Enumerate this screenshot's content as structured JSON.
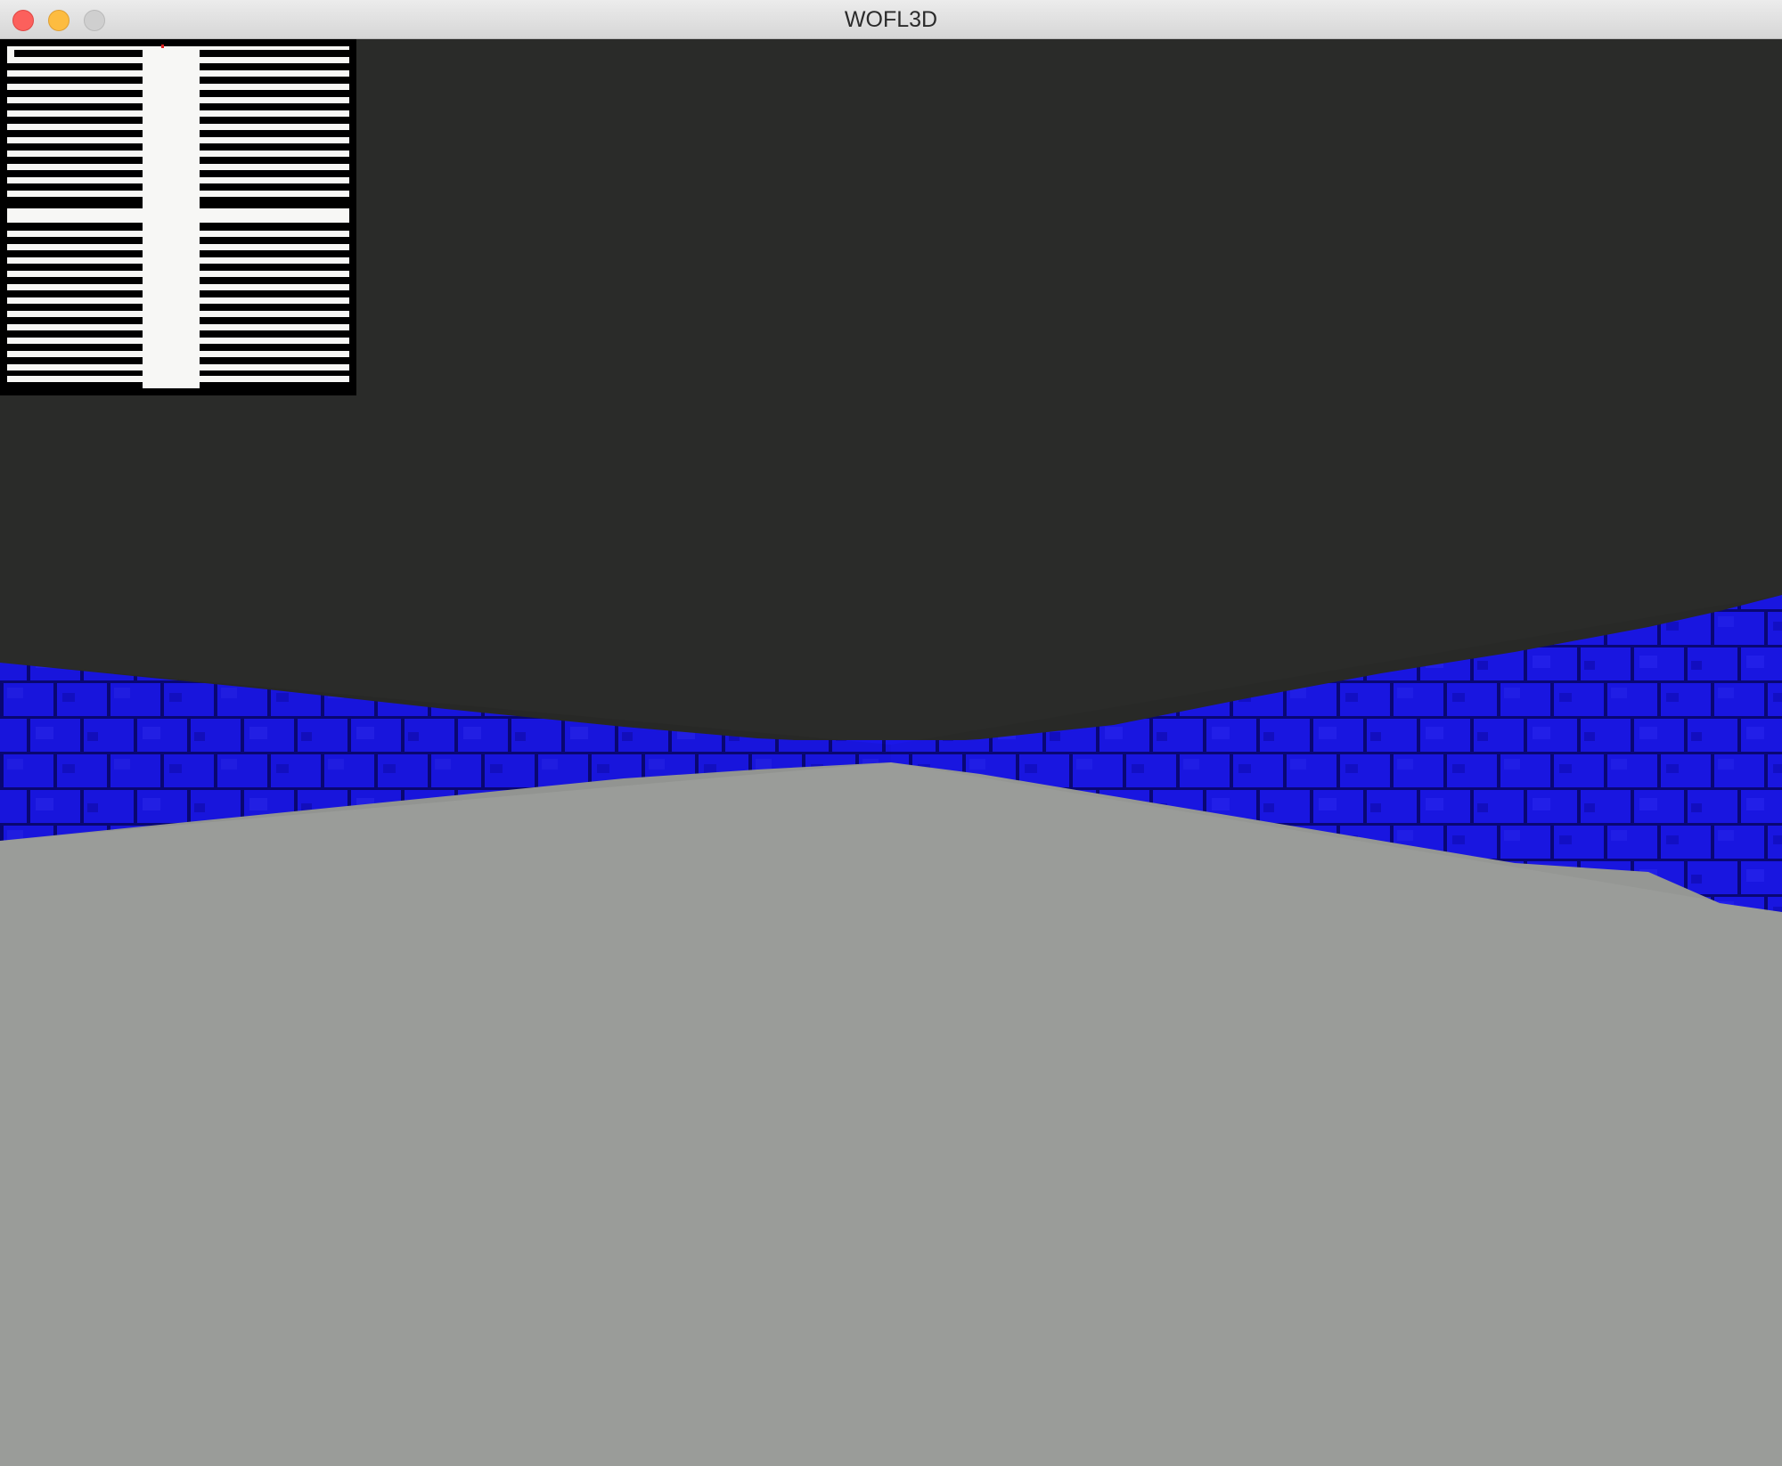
{
  "window": {
    "title": "WOFL3D"
  },
  "scene": {
    "ceiling_color": "#2a2b29",
    "floor_color": "#9a9c99",
    "wall_color": "#1a17e8",
    "wall_texture": "blue-stone-brick"
  },
  "minimap": {
    "background_color": "#000000",
    "wall_color": "#ffffff",
    "player_marker_color": "#e02020"
  }
}
